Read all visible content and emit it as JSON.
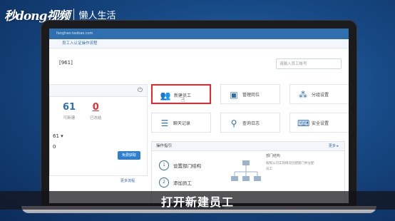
{
  "brand": {
    "logo": "秒dong视频",
    "slogan": "懒人生活"
  },
  "browser": {
    "address": "fanghao.taobao.com"
  },
  "nav": {
    "link": "员工入认证操作流程"
  },
  "page": {
    "code": "[961]"
  },
  "search": {
    "placeholder": "请输入员工帐号"
  },
  "stats": [
    {
      "value": "61",
      "label": "可新建"
    },
    {
      "value": "0",
      "label": "已冻结"
    }
  ],
  "left_panel": {
    "row2": "61 ▾",
    "row3": "0",
    "button_label": "免费获取",
    "more_label": "更多流程"
  },
  "tiles": [
    {
      "icon": "users-icon",
      "label": "新建员工"
    },
    {
      "icon": "id-card-icon",
      "label": "管理岗位"
    },
    {
      "icon": "group-icon",
      "label": "分组设置"
    },
    {
      "icon": "document-icon",
      "label": "聊天记录"
    },
    {
      "icon": "search-icon",
      "label": "查询日志"
    },
    {
      "icon": "keyboard-icon",
      "label": "安全设置"
    }
  ],
  "ops": {
    "title": "操作指引",
    "more": "更多 ▸",
    "steps": [
      {
        "num": "1",
        "label": "设置部门结构"
      },
      {
        "num": "2",
        "label": "添加员工"
      }
    ],
    "org_title": "部门结构",
    "org_desc": "按照公司实际情况创建部门并分配员工"
  },
  "subtitle": "打开新建员工"
}
